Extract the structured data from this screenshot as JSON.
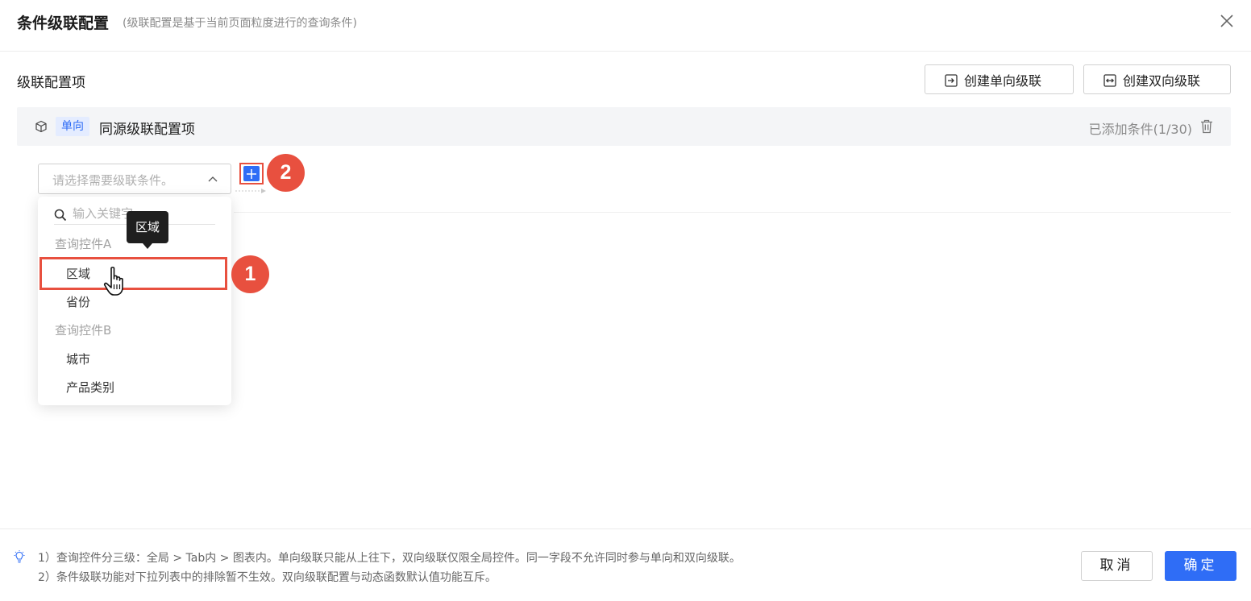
{
  "dialog": {
    "title": "条件级联配置",
    "subtitle": "(级联配置是基于当前页面粒度进行的查询条件)"
  },
  "section": {
    "title": "级联配置项",
    "btn_oneway": "创建单向级联",
    "btn_twoway": "创建双向级联"
  },
  "config_item": {
    "tag": "单向",
    "name": "同源级联配置项",
    "added_count": "已添加条件(1/30)"
  },
  "select": {
    "placeholder": "请选择需要级联条件。"
  },
  "dropdown": {
    "search_placeholder": "输入关键字",
    "groups": [
      {
        "label": "查询控件A",
        "options": [
          "区域",
          "省份"
        ]
      },
      {
        "label": "查询控件B",
        "options": [
          "城市",
          "产品类别"
        ]
      }
    ]
  },
  "tooltip": "区域",
  "badges": [
    "1",
    "2"
  ],
  "footer": {
    "notes": [
      "1）查询控件分三级：全局 > Tab内 > 图表内。单向级联只能从上往下，双向级联仅限全局控件。同一字段不允许同时参与单向和双向级联。",
      "2）条件级联功能对下拉列表中的排除暂不生效。双向级联配置与动态函数默认值功能互斥。"
    ],
    "cancel": "取消",
    "ok": "确定"
  },
  "colors": {
    "primary": "#2f6df6",
    "highlight": "#e8503f",
    "tag_bg": "#e4ecff"
  }
}
